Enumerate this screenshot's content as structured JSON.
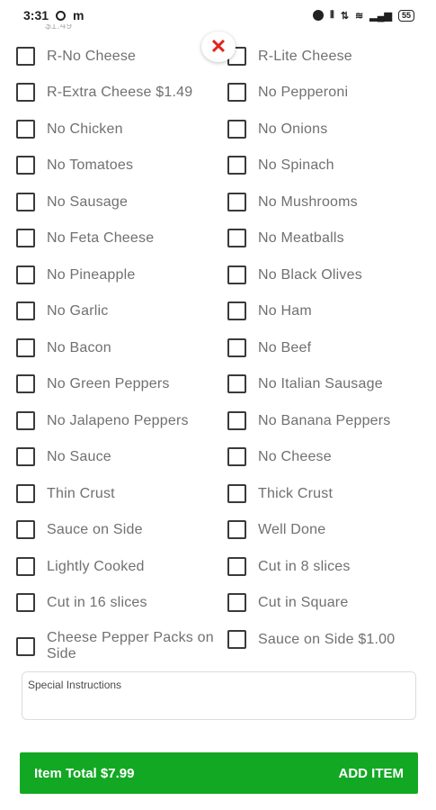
{
  "status_bar": {
    "time": "3:31",
    "icons_left": [
      "circle-icon",
      "m-icon"
    ],
    "icons_right": [
      "alarm-icon",
      "vibrate-icon",
      "data-icon",
      "wifi-icon",
      "signal-icon"
    ],
    "battery": "55"
  },
  "cut_text": "$1.49",
  "close_symbol": "✕",
  "options": [
    {
      "label": "R-No Cheese"
    },
    {
      "label": "R-Lite Cheese"
    },
    {
      "label": "R-Extra Cheese $1.49"
    },
    {
      "label": "No Pepperoni"
    },
    {
      "label": "No Chicken"
    },
    {
      "label": "No Onions"
    },
    {
      "label": "No Tomatoes"
    },
    {
      "label": "No Spinach"
    },
    {
      "label": "No Sausage"
    },
    {
      "label": "No Mushrooms"
    },
    {
      "label": "No Feta Cheese"
    },
    {
      "label": "No Meatballs"
    },
    {
      "label": "No Pineapple"
    },
    {
      "label": "No Black Olives"
    },
    {
      "label": "No Garlic"
    },
    {
      "label": "No Ham"
    },
    {
      "label": "No Bacon"
    },
    {
      "label": "No Beef"
    },
    {
      "label": "No Green Peppers"
    },
    {
      "label": "No Italian Sausage"
    },
    {
      "label": "No Jalapeno Peppers"
    },
    {
      "label": "No Banana Peppers"
    },
    {
      "label": "No Sauce"
    },
    {
      "label": "No Cheese"
    },
    {
      "label": "Thin Crust"
    },
    {
      "label": "Thick Crust"
    },
    {
      "label": "Sauce on Side"
    },
    {
      "label": "Well Done"
    },
    {
      "label": "Lightly Cooked"
    },
    {
      "label": "Cut in 8 slices"
    },
    {
      "label": "Cut in 16 slices"
    },
    {
      "label": "Cut in Square"
    },
    {
      "label": "Cheese Pepper Packs on Side"
    },
    {
      "label": "Sauce on Side $1.00"
    }
  ],
  "special_instructions": {
    "label": "Special Instructions",
    "value": ""
  },
  "footer": {
    "total": "Item Total $7.99",
    "add": "ADD ITEM"
  },
  "colors": {
    "accent_green": "#13a824",
    "close_red": "#e2231a"
  }
}
